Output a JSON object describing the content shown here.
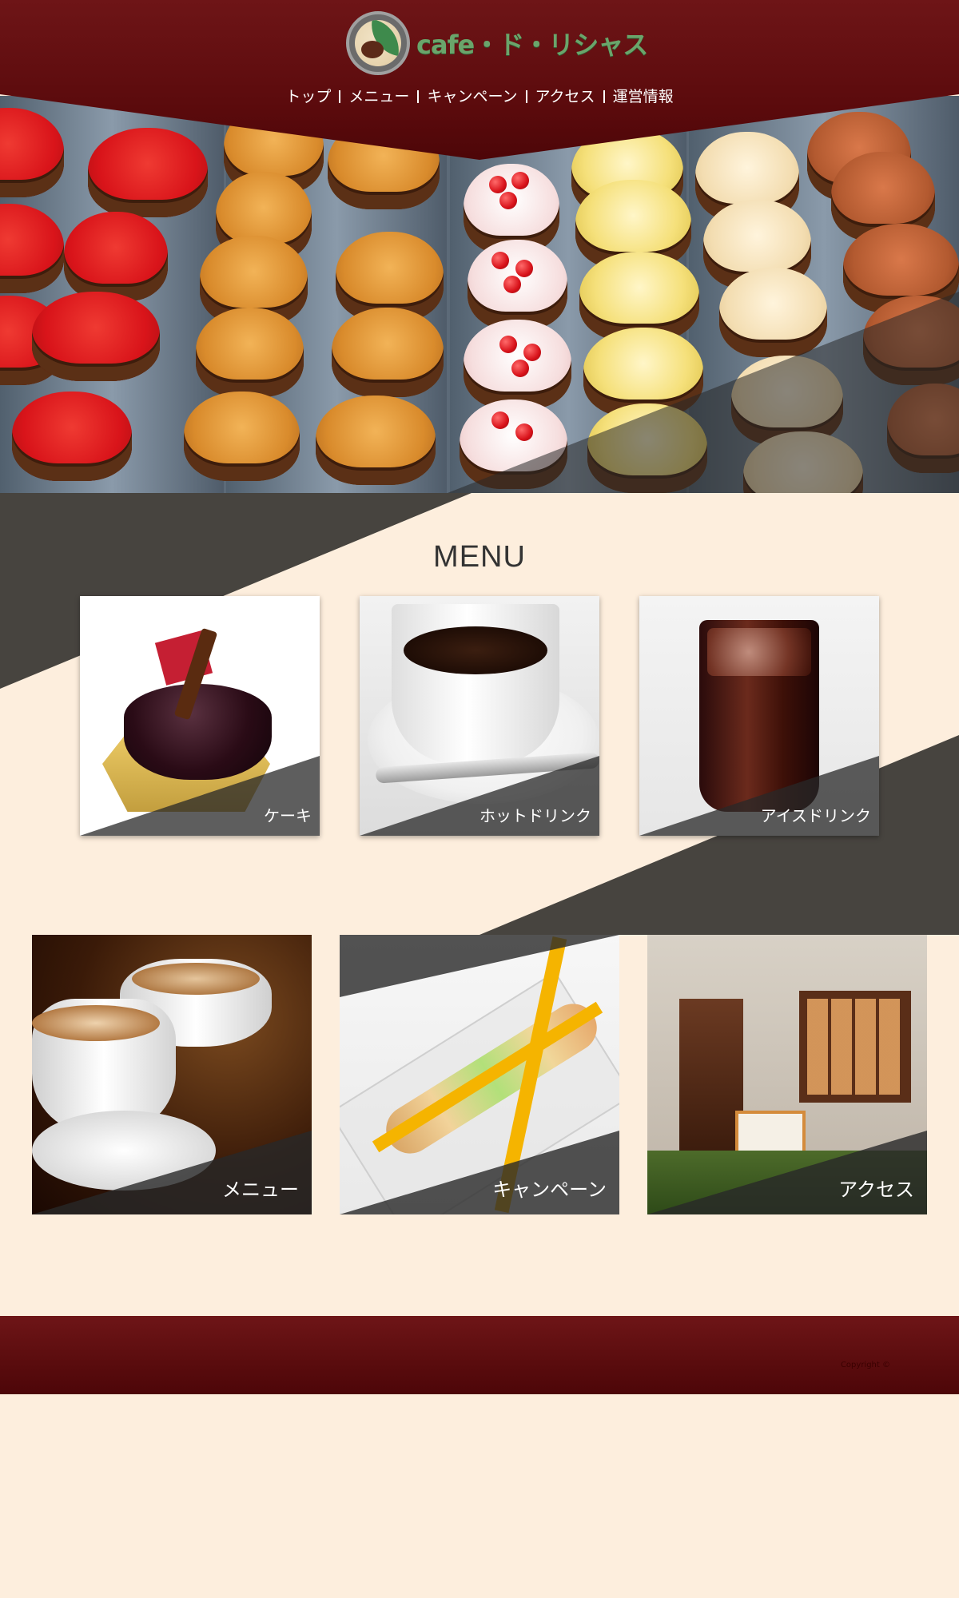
{
  "header": {
    "logo_text": "cafe・ド・リシャス",
    "nav": [
      "トップ",
      "メニュー",
      "キャンペーン",
      "アクセス",
      "運営情報"
    ]
  },
  "menu": {
    "title": "MENU",
    "cards": [
      {
        "label": "ケーキ"
      },
      {
        "label": "ホットドリンク"
      },
      {
        "label": "アイスドリンク"
      }
    ]
  },
  "tiles": [
    {
      "label": "メニュー"
    },
    {
      "label": "キャンペーン"
    },
    {
      "label": "アクセス"
    }
  ],
  "footer": {
    "copyright": "Copyright ©"
  },
  "colors": {
    "header": "#5a0a0c",
    "page_bg": "#fdeedd",
    "band": "#47443f",
    "logo_green": "#6aa56b"
  }
}
